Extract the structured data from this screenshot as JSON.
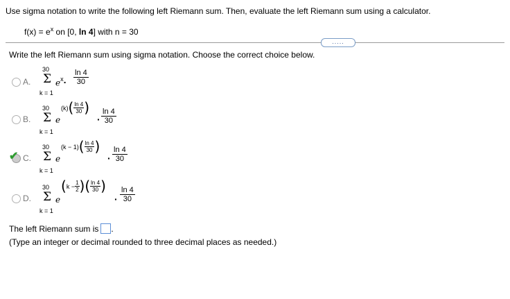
{
  "question": "Use sigma notation to write the following left Riemann sum. Then, evaluate the left Riemann sum using a calculator.",
  "problem": {
    "fx_prefix": "f(x) = e",
    "fx_sup": "x",
    "fx_rest": " on [0, ",
    "ln4_bold": "ln 4",
    "n_text": "] with n = 30"
  },
  "expand_dots": ".....",
  "instruction": "Write the left Riemann sum using sigma notation. Choose the correct choice below.",
  "sigma": "Σ",
  "upper": "30",
  "lower": "k = 1",
  "e": "e",
  "ln4": "ln 4",
  "den": "30",
  "options": {
    "a": {
      "label": "A.",
      "exp": "x",
      "selected": false
    },
    "b": {
      "label": "B.",
      "exp": "(k)",
      "selected": false
    },
    "c": {
      "label": "C.",
      "exp": "(k − 1)",
      "selected": true
    },
    "d": {
      "label": "D.",
      "exp_prefix": "k −",
      "half_n": "1",
      "half_d": "2",
      "selected": false
    }
  },
  "answer_label": "The left Riemann sum is",
  "hint": "(Type an integer or decimal rounded to three decimal places as needed.)"
}
